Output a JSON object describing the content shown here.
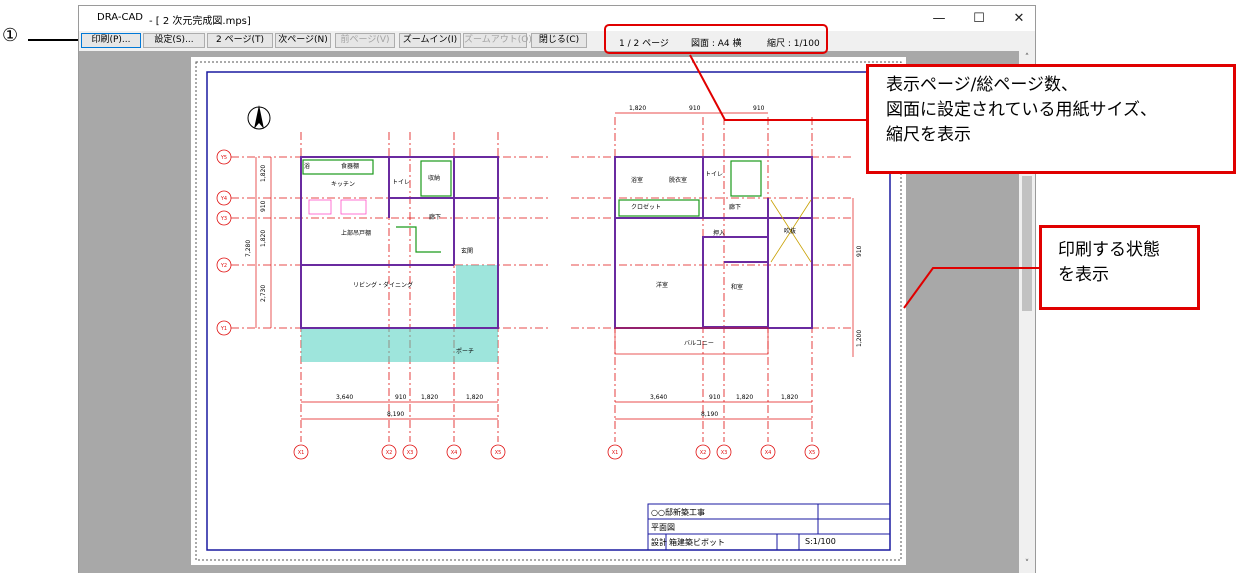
{
  "marker": {
    "label": "①"
  },
  "window": {
    "app_title": "DRA-CAD",
    "doc_title": "- [ 2 次元完成図.mps]",
    "controls": {
      "minimize": "—",
      "maximize": "☐",
      "close": "✕"
    }
  },
  "toolbar": {
    "buttons": [
      {
        "label": "印刷(P)...",
        "state": "active"
      },
      {
        "label": "設定(S)...",
        "state": "enabled"
      },
      {
        "label": "2 ページ(T)",
        "state": "enabled"
      },
      {
        "label": "次ページ(N)",
        "state": "enabled"
      },
      {
        "label": "前ページ(V)",
        "state": "disabled"
      },
      {
        "label": "ズームイン(I)",
        "state": "enabled"
      },
      {
        "label": "ズームアウト(O)",
        "state": "disabled"
      },
      {
        "label": "閉じる(C)",
        "state": "enabled"
      }
    ],
    "status": {
      "page": "1 / 2 ページ",
      "paper": "図面 : A4 横",
      "scale": "縮尺 : 1/100"
    }
  },
  "drawing": {
    "title_block": {
      "project": "○○邸新築工事",
      "sheet": "平面図",
      "design_label": "設計",
      "designer": "箱建築ビボット",
      "scale": "S:1/100"
    },
    "left_plan": {
      "rooms": [
        "食器棚",
        "キッチン",
        "トイレ",
        "収納",
        "廊下",
        "上部吊戸棚",
        "玄関",
        "リビング・ダイニング",
        "ポーチ",
        "浴"
      ],
      "dims_bottom": [
        "3,640",
        "910",
        "1,820",
        "1,820"
      ],
      "dim_total": "8,190",
      "dims_left": [
        "1,820",
        "910",
        "1,820",
        "2,730"
      ],
      "dim_left_total": "7,280",
      "grid_x": [
        "X1",
        "X2",
        "X3",
        "X4",
        "X5"
      ],
      "grid_y": [
        "Y5",
        "Y4",
        "Y3",
        "Y2",
        "Y1"
      ]
    },
    "right_plan": {
      "rooms": [
        "浴室",
        "脱衣室",
        "トイレ",
        "クロゼット",
        "廊下",
        "押入",
        "吹抜",
        "洋室",
        "和室",
        "バルコニー"
      ],
      "dims_top": [
        "1,820",
        "910",
        "910"
      ],
      "dims_bottom": [
        "3,640",
        "910",
        "1,820",
        "1,820"
      ],
      "dim_total": "8,190",
      "dims_right": [
        "910",
        "1,200"
      ],
      "grid_x": [
        "X1",
        "X2",
        "X3",
        "X4",
        "X5"
      ]
    }
  },
  "callouts": {
    "page_info": [
      "表示ページ/総ページ数、",
      "図面に設定されている用紙サイズ、",
      "縮尺を表示"
    ],
    "print_state": [
      "印刷する状態",
      "を表示"
    ]
  }
}
